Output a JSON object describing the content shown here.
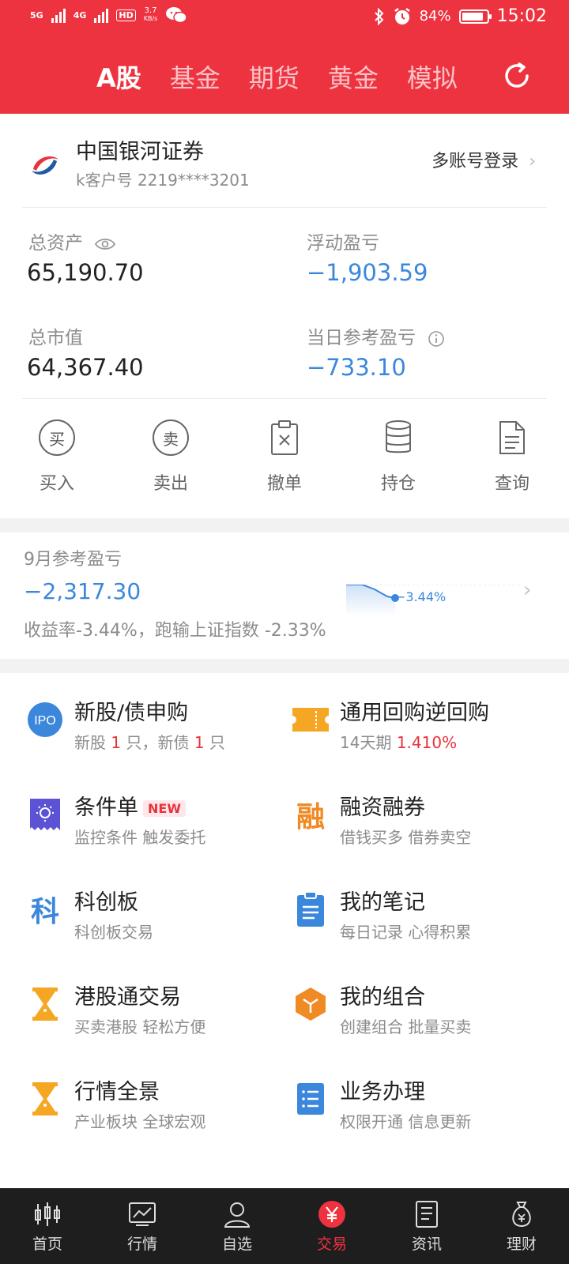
{
  "status": {
    "net1": "5G",
    "net2": "4G",
    "hd": "HD",
    "speed": "3.7",
    "speed_unit": "KB/s",
    "battery": "84%",
    "time": "15:02"
  },
  "tabs": [
    "A股",
    "基金",
    "期货",
    "黄金",
    "模拟"
  ],
  "account": {
    "broker": "中国银河证券",
    "customer_no": "k客户号 2219****3201",
    "multi_login": "多账号登录",
    "total_assets_label": "总资产",
    "total_assets": "65,190.70",
    "floating_pl_label": "浮动盈亏",
    "floating_pl": "−1,903.59",
    "market_value_label": "总市值",
    "market_value": "64,367.40",
    "daily_pl_label": "当日参考盈亏",
    "daily_pl": "−733.10"
  },
  "quick_actions": [
    {
      "label": "买入",
      "glyph": "买"
    },
    {
      "label": "卖出",
      "glyph": "卖"
    },
    {
      "label": "撤单",
      "glyph": ""
    },
    {
      "label": "持仓",
      "glyph": ""
    },
    {
      "label": "查询",
      "glyph": ""
    }
  ],
  "monthly": {
    "label": "9月参考盈亏",
    "value": "−2,317.30",
    "desc": "收益率-3.44%，跑输上证指数 -2.33%",
    "spark_label": "−3.44%"
  },
  "menu": [
    {
      "title": "新股/债申购",
      "sub_a": "新股 ",
      "sub_b": "1",
      "sub_c": " 只，新债 ",
      "sub_d": "1",
      "sub_e": " 只",
      "icon": "ipo-icon",
      "icon_text": "IPO"
    },
    {
      "title": "通用回购逆回购",
      "sub_a": "14天期 ",
      "sub_b": "1.410%",
      "icon": "ticket-icon"
    },
    {
      "title": "条件单",
      "badge": "NEW",
      "sub": "监控条件 触发委托",
      "icon": "condition-order-icon"
    },
    {
      "title": "融资融券",
      "sub": "借钱买多 借券卖空",
      "icon": "margin-icon",
      "icon_text": "融"
    },
    {
      "title": "科创板",
      "sub": "科创板交易",
      "icon": "star-market-icon",
      "icon_text": "科"
    },
    {
      "title": "我的笔记",
      "sub": "每日记录 心得积累",
      "icon": "notes-icon"
    },
    {
      "title": "港股通交易",
      "sub": "买卖港股 轻松方便",
      "icon": "hourglass-icon"
    },
    {
      "title": "我的组合",
      "sub": "创建组合 批量买卖",
      "icon": "portfolio-icon"
    },
    {
      "title": "行情全景",
      "sub": "产业板块 全球宏观",
      "icon": "hourglass-icon"
    },
    {
      "title": "业务办理",
      "sub": "权限开通 信息更新",
      "icon": "list-icon"
    }
  ],
  "bottom_nav": [
    "首页",
    "行情",
    "自选",
    "交易",
    "资讯",
    "理财"
  ],
  "colors": {
    "brand_red": "#ee3340",
    "negative_blue": "#3b87dc",
    "orange": "#f5a623"
  }
}
